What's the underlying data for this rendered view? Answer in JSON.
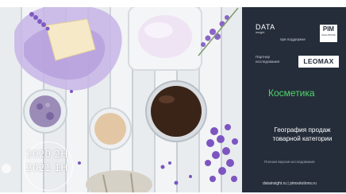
{
  "photo": {
    "years": [
      "2020 2H",
      "2021 1H"
    ]
  },
  "panel": {
    "logo_datai": {
      "line1": "DATA",
      "line2": "insight"
    },
    "support_text": "при поддержке",
    "pim_logo": {
      "line1": "PIM",
      "line2": "SOLUTIONS"
    },
    "partner_text": "Партнер исследования",
    "leomax_logo": "LEOMAX",
    "category": "Косметика",
    "title": "География продаж товарной категории",
    "full_version": "Полная версия исследования",
    "sites": "datainsight.ru  |  pimsolutions.ru"
  },
  "colors": {
    "panel_bg": "#252d3a",
    "accent_green": "#4fd66a",
    "lavender": "#7f5cc2"
  }
}
